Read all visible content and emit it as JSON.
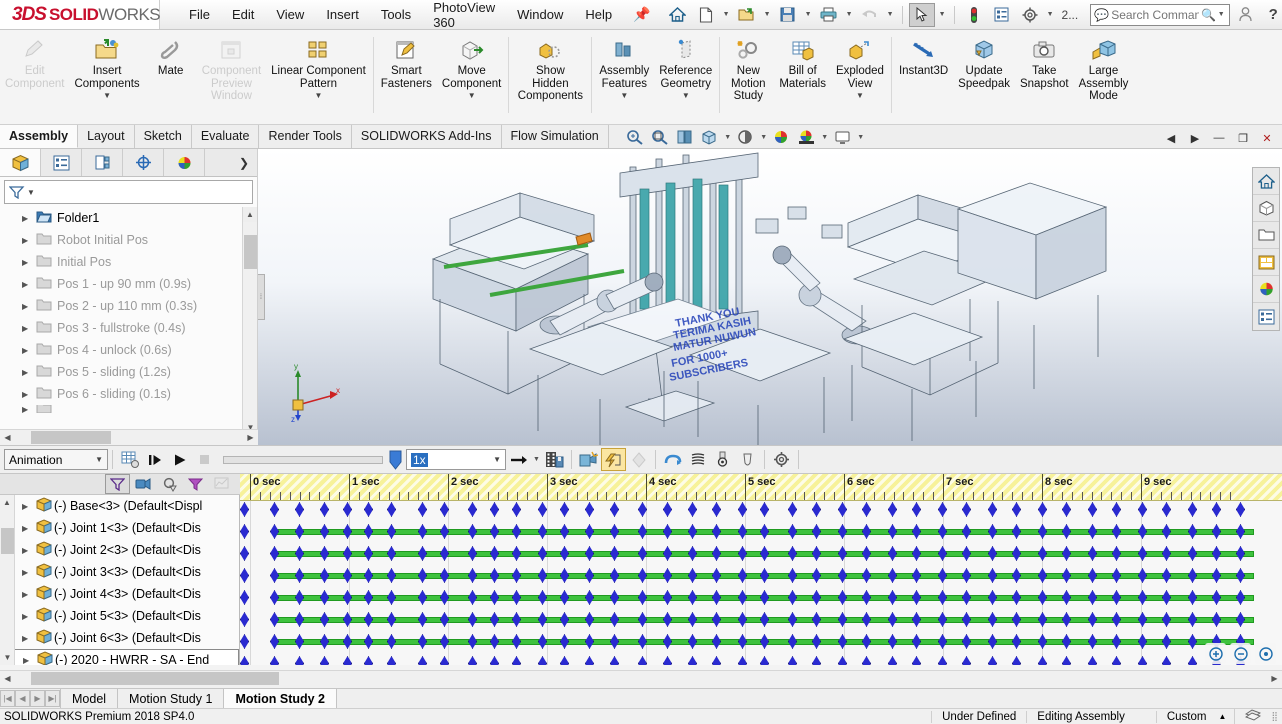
{
  "app": {
    "logo_ds": "3DS",
    "logo_solid": "SOLID",
    "logo_works": "WORKS",
    "version_status": "SOLIDWORKS Premium 2018 SP4.0"
  },
  "menu": {
    "items": [
      {
        "label": "File"
      },
      {
        "label": "Edit"
      },
      {
        "label": "View"
      },
      {
        "label": "Insert"
      },
      {
        "label": "Tools"
      },
      {
        "label": "PhotoView 360"
      },
      {
        "label": "Window"
      },
      {
        "label": "Help"
      }
    ],
    "pin_icon": "pin-icon"
  },
  "quick_access": {
    "buttons": [
      {
        "name": "home-button",
        "icon": "⌂"
      },
      {
        "name": "new-document-button",
        "icon": "🗎"
      },
      {
        "name": "open-document-button",
        "icon": "📂"
      },
      {
        "name": "save-button",
        "icon": "💾"
      },
      {
        "name": "print-button",
        "icon": "🖨"
      },
      {
        "name": "undo-button",
        "icon": "↩"
      },
      {
        "name": "select-button",
        "icon": "➤"
      },
      {
        "name": "rebuild-button",
        "icon": "🚦"
      },
      {
        "name": "options-list-button",
        "icon": "▤"
      },
      {
        "name": "settings-gear-button",
        "icon": "⚙"
      }
    ],
    "overflow_label": "2...",
    "search": {
      "placeholder": "Search Commands",
      "value": "",
      "icon": "search-icon"
    },
    "user_icon": "user-icon",
    "help_icon": "help-icon"
  },
  "window_controls": {
    "minimize": "—",
    "restore": "❐",
    "close": "✕"
  },
  "ribbon": {
    "groups": [
      {
        "buttons": [
          {
            "label": "Edit\nComponent",
            "icon": "✎",
            "disabled": true,
            "caret": false,
            "name": "edit-component-button"
          },
          {
            "label": "Insert\nComponents",
            "icon": "📂",
            "disabled": false,
            "caret": true,
            "name": "insert-components-button"
          },
          {
            "label": "Mate",
            "icon": "📎",
            "disabled": false,
            "caret": false,
            "name": "mate-button"
          },
          {
            "label": "Component\nPreview\nWindow",
            "icon": "▣",
            "disabled": true,
            "caret": false,
            "name": "component-preview-window-button"
          },
          {
            "label": "Linear Component\nPattern",
            "icon": "▦",
            "disabled": false,
            "caret": true,
            "name": "linear-component-pattern-button"
          },
          {
            "label": "Smart\nFasteners",
            "icon": "🔩",
            "disabled": false,
            "caret": false,
            "name": "smart-fasteners-button"
          },
          {
            "label": "Move\nComponent",
            "icon": "⬓",
            "disabled": false,
            "caret": true,
            "name": "move-component-button"
          }
        ]
      },
      {
        "buttons": [
          {
            "label": "Show\nHidden\nComponents",
            "icon": "◍",
            "disabled": false,
            "caret": false,
            "name": "show-hidden-components-button"
          }
        ]
      },
      {
        "buttons": [
          {
            "label": "Assembly\nFeatures",
            "icon": "▥",
            "disabled": false,
            "caret": true,
            "name": "assembly-features-button"
          },
          {
            "label": "Reference\nGeometry",
            "icon": "⬗",
            "disabled": false,
            "caret": true,
            "name": "reference-geometry-button"
          }
        ]
      },
      {
        "buttons": [
          {
            "label": "New\nMotion\nStudy",
            "icon": "✳",
            "disabled": false,
            "caret": false,
            "name": "new-motion-study-button"
          },
          {
            "label": "Bill of\nMaterials",
            "icon": "▤",
            "disabled": false,
            "caret": false,
            "name": "bill-of-materials-button"
          },
          {
            "label": "Exploded\nView",
            "icon": "✦",
            "disabled": false,
            "caret": true,
            "name": "exploded-view-button"
          }
        ]
      },
      {
        "buttons": [
          {
            "label": "Instant3D",
            "icon": "↘",
            "disabled": false,
            "caret": false,
            "name": "instant3d-button"
          },
          {
            "label": "Update\nSpeedpak",
            "icon": "⬒",
            "disabled": false,
            "caret": false,
            "name": "update-speedpak-button"
          },
          {
            "label": "Take\nSnapshot",
            "icon": "📷",
            "disabled": false,
            "caret": false,
            "name": "take-snapshot-button"
          },
          {
            "label": "Large\nAssembly\nMode",
            "icon": "⬔",
            "disabled": false,
            "caret": false,
            "name": "large-assembly-mode-button"
          }
        ]
      }
    ]
  },
  "command_tabs": {
    "items": [
      {
        "label": "Assembly",
        "active": true
      },
      {
        "label": "Layout",
        "active": false
      },
      {
        "label": "Sketch",
        "active": false
      },
      {
        "label": "Evaluate",
        "active": false
      },
      {
        "label": "Render Tools",
        "active": false
      },
      {
        "label": "SOLIDWORKS Add-Ins",
        "active": false
      },
      {
        "label": "Flow Simulation",
        "active": false
      }
    ],
    "view_tools": [
      {
        "name": "zoom-to-fit-icon",
        "icon": "🔍",
        "caret": false
      },
      {
        "name": "zoom-to-area-icon",
        "icon": "🔎",
        "caret": false
      },
      {
        "name": "section-view-icon",
        "icon": "◫",
        "caret": false
      },
      {
        "name": "view-orientation-icon",
        "icon": "⬓",
        "caret": true
      },
      {
        "name": "display-style-icon",
        "icon": "◉",
        "caret": true
      },
      {
        "name": "edit-appearance-icon",
        "icon": "🎨",
        "caret": false
      },
      {
        "name": "apply-scene-icon",
        "icon": "🌈",
        "caret": true
      },
      {
        "name": "view-settings-icon",
        "icon": "🖥",
        "caret": true
      }
    ],
    "window_controls": [
      "◀",
      "▶",
      "—",
      "❐",
      "✕"
    ]
  },
  "feature_tree": {
    "tabs": [
      {
        "name": "feature-manager-tab",
        "icon": "🧊",
        "active": true
      },
      {
        "name": "property-manager-tab",
        "icon": "▤",
        "active": false
      },
      {
        "name": "configuration-manager-tab",
        "icon": "🔖",
        "active": false
      },
      {
        "name": "dimxpert-manager-tab",
        "icon": "⊕",
        "active": false
      },
      {
        "name": "display-manager-tab",
        "icon": "🎨",
        "active": false
      }
    ],
    "expand_icon": "chevron-right-icon",
    "filter": {
      "placeholder": "",
      "value": "",
      "icon": "filter-icon"
    },
    "nodes": [
      {
        "label": "Folder1",
        "dim": false,
        "icon": "folder-open-icon"
      },
      {
        "label": "Robot Initial Pos",
        "dim": true,
        "icon": "folder-icon"
      },
      {
        "label": "Initial Pos",
        "dim": true,
        "icon": "folder-icon"
      },
      {
        "label": "Pos 1 - up 90 mm (0.9s)",
        "dim": true,
        "icon": "folder-icon"
      },
      {
        "label": "Pos 2 - up 110 mm (0.3s)",
        "dim": true,
        "icon": "folder-icon"
      },
      {
        "label": "Pos 3 - fullstroke (0.4s)",
        "dim": true,
        "icon": "folder-icon"
      },
      {
        "label": "Pos 4 - unlock (0.6s)",
        "dim": true,
        "icon": "folder-icon"
      },
      {
        "label": "Pos 5 - sliding (1.2s)",
        "dim": true,
        "icon": "folder-icon"
      },
      {
        "label": "Pos 6 - sliding (0.1s)",
        "dim": true,
        "icon": "folder-icon"
      }
    ]
  },
  "viewport": {
    "right_dock": [
      {
        "name": "view-home-icon",
        "icon": "⌂"
      },
      {
        "name": "appearances-icon",
        "icon": "◪"
      },
      {
        "name": "file-explorer-icon",
        "icon": "📂"
      },
      {
        "name": "view-palette-icon",
        "icon": "▣"
      },
      {
        "name": "appearances-scenes-icon",
        "icon": "🎨"
      },
      {
        "name": "custom-properties-icon",
        "icon": "▤"
      }
    ],
    "axis_labels": {
      "x": "x",
      "y": "y",
      "z": "z"
    }
  },
  "animation_toolbar": {
    "mode_select": {
      "value": "Animation",
      "name": "animation-mode-select"
    },
    "buttons": [
      {
        "name": "calculate-button",
        "icon": "▦",
        "state": "normal"
      },
      {
        "name": "play-from-start-button",
        "icon": "▌▶",
        "state": "normal"
      },
      {
        "name": "play-button",
        "icon": "▶",
        "state": "normal"
      },
      {
        "name": "stop-button",
        "icon": "■",
        "state": "disabled"
      }
    ],
    "speed_select": {
      "value": "1x",
      "name": "playback-speed-select"
    },
    "playback_mode": {
      "icon": "➜",
      "name": "playback-mode-button"
    },
    "tools": [
      {
        "name": "save-animation-button",
        "icon": "🎞",
        "state": "normal"
      },
      {
        "name": "animation-wizard-button",
        "icon": "🪄",
        "state": "normal"
      },
      {
        "name": "motor-button",
        "icon": "⚡",
        "state": "selected"
      },
      {
        "name": "spring-button",
        "icon": "◈",
        "state": "disabled"
      },
      {
        "name": "damper-button",
        "icon": "⊃",
        "state": "normal"
      },
      {
        "name": "force-button",
        "icon": "≋",
        "state": "normal"
      },
      {
        "name": "contact-button",
        "icon": "⚲",
        "state": "normal"
      },
      {
        "name": "gravity-button",
        "icon": "⬯",
        "state": "normal"
      },
      {
        "name": "motion-study-properties-button",
        "icon": "⚙",
        "state": "normal"
      }
    ]
  },
  "timeline": {
    "tree_tools": [
      {
        "name": "filter-all-icon",
        "icon": "⑂",
        "state": "selected"
      },
      {
        "name": "filter-driving-icon",
        "icon": "📹",
        "state": "normal"
      },
      {
        "name": "filter-selected-icon",
        "icon": "⚙",
        "state": "normal"
      },
      {
        "name": "filter-results-icon",
        "icon": "⑂",
        "state": "normal"
      },
      {
        "name": "filter-plot-icon",
        "icon": "📈",
        "state": "disabled"
      }
    ],
    "nodes": [
      {
        "label": "(-) Base<3>  (Default<Displ",
        "selected": false
      },
      {
        "label": "(-) Joint 1<3>  (Default<Dis",
        "selected": false
      },
      {
        "label": "(-) Joint 2<3>  (Default<Dis",
        "selected": false
      },
      {
        "label": "(-) Joint 3<3>  (Default<Dis",
        "selected": false
      },
      {
        "label": "(-) Joint 4<3>  (Default<Dis",
        "selected": false
      },
      {
        "label": "(-) Joint 5<3>  (Default<Dis",
        "selected": false
      },
      {
        "label": "(-) Joint 6<3>  (Default<Dis",
        "selected": false
      },
      {
        "label": "(-) 2020 - HWRR - SA - End",
        "selected": true
      }
    ],
    "ruler": {
      "ticks": [
        "0 sec",
        "1 sec",
        "2 sec",
        "3 sec",
        "4 sec",
        "5 sec",
        "6 sec",
        "7 sec",
        "8 sec",
        "9 sec"
      ],
      "pixels_per_second": 99,
      "minor_ticks_per_second": 10
    },
    "key_rows": [
      {
        "bar": null,
        "keys": [
          0,
          30,
          55,
          80,
          103,
          124,
          147,
          178,
          200,
          228,
          250,
          272,
          298,
          320,
          345,
          370,
          398,
          423,
          448,
          472,
          498,
          520,
          548,
          572,
          598,
          622,
          648,
          672,
          698,
          722,
          748,
          772,
          798,
          822,
          848,
          872,
          898,
          922,
          948,
          972,
          996
        ]
      },
      {
        "bar": {
          "start": 30,
          "end": 1010
        },
        "keys": [
          0,
          30,
          55,
          80,
          103,
          124,
          147,
          178,
          200,
          228,
          250,
          272,
          298,
          320,
          345,
          370,
          398,
          423,
          448,
          472,
          498,
          520,
          548,
          572,
          598,
          622,
          648,
          672,
          698,
          722,
          748,
          772,
          798,
          822,
          848,
          872,
          898,
          922,
          948,
          972,
          996
        ]
      },
      {
        "bar": {
          "start": 30,
          "end": 1010
        },
        "keys": [
          0,
          30,
          55,
          80,
          103,
          124,
          147,
          178,
          200,
          228,
          250,
          272,
          298,
          320,
          345,
          370,
          398,
          423,
          448,
          472,
          498,
          520,
          548,
          572,
          598,
          622,
          648,
          672,
          698,
          722,
          748,
          772,
          798,
          822,
          848,
          872,
          898,
          922,
          948,
          972,
          996
        ]
      },
      {
        "bar": {
          "start": 30,
          "end": 1010
        },
        "keys": [
          0,
          30,
          55,
          80,
          103,
          124,
          147,
          178,
          200,
          228,
          250,
          272,
          298,
          320,
          345,
          370,
          398,
          423,
          448,
          472,
          498,
          520,
          548,
          572,
          598,
          622,
          648,
          672,
          698,
          722,
          748,
          772,
          798,
          822,
          848,
          872,
          898,
          922,
          948,
          972,
          996
        ]
      },
      {
        "bar": {
          "start": 30,
          "end": 1010
        },
        "keys": [
          0,
          30,
          55,
          80,
          103,
          124,
          147,
          178,
          200,
          228,
          250,
          272,
          298,
          320,
          345,
          370,
          398,
          423,
          448,
          472,
          498,
          520,
          548,
          572,
          598,
          622,
          648,
          672,
          698,
          722,
          748,
          772,
          798,
          822,
          848,
          872,
          898,
          922,
          948,
          972,
          996
        ]
      },
      {
        "bar": {
          "start": 30,
          "end": 1010
        },
        "keys": [
          0,
          30,
          55,
          80,
          103,
          124,
          147,
          178,
          200,
          228,
          250,
          272,
          298,
          320,
          345,
          370,
          398,
          423,
          448,
          472,
          498,
          520,
          548,
          572,
          598,
          622,
          648,
          672,
          698,
          722,
          748,
          772,
          798,
          822,
          848,
          872,
          898,
          922,
          948,
          972,
          996
        ]
      },
      {
        "bar": {
          "start": 30,
          "end": 1010
        },
        "keys": [
          0,
          30,
          55,
          80,
          103,
          124,
          147,
          178,
          200,
          228,
          250,
          272,
          298,
          320,
          345,
          370,
          398,
          423,
          448,
          472,
          498,
          520,
          548,
          572,
          598,
          622,
          648,
          672,
          698,
          722,
          748,
          772,
          798,
          822,
          848,
          872,
          898,
          922,
          948,
          972,
          996
        ]
      },
      {
        "bar": null,
        "keys": [
          0,
          30,
          55,
          80,
          103,
          124,
          147,
          178,
          200,
          228,
          250,
          272,
          298,
          320,
          345,
          370,
          398,
          423,
          448,
          472,
          498,
          520,
          548,
          572,
          598,
          622,
          648,
          672,
          698,
          722,
          748,
          772,
          798,
          822,
          848,
          872,
          898,
          922,
          948,
          972,
          996
        ]
      }
    ],
    "zoom_buttons": [
      {
        "name": "zoom-in-timeline-button",
        "icon": "⊕"
      },
      {
        "name": "zoom-out-timeline-button",
        "icon": "⊖"
      },
      {
        "name": "zoom-fit-timeline-button",
        "icon": "⊙"
      }
    ]
  },
  "document_tabs": {
    "nav_buttons": [
      "|◀",
      "◀",
      "▶",
      "▶|"
    ],
    "items": [
      {
        "label": "Model",
        "active": false
      },
      {
        "label": "Motion Study 1",
        "active": false
      },
      {
        "label": "Motion Study 2",
        "active": true
      }
    ]
  },
  "status_bar": {
    "left": "SOLIDWORKS Premium 2018 SP4.0",
    "segments": [
      "Under Defined",
      "Editing Assembly",
      "",
      "Custom"
    ],
    "caret": "▲",
    "icon": "sheet-stack-icon"
  },
  "colors": {
    "brand_red": "#c8102e",
    "timeline_yellow": "#f7f29a",
    "key_blue": "#2a2ad0",
    "bar_green": "#3ec23e",
    "selection_blue": "#2a6fc0"
  }
}
